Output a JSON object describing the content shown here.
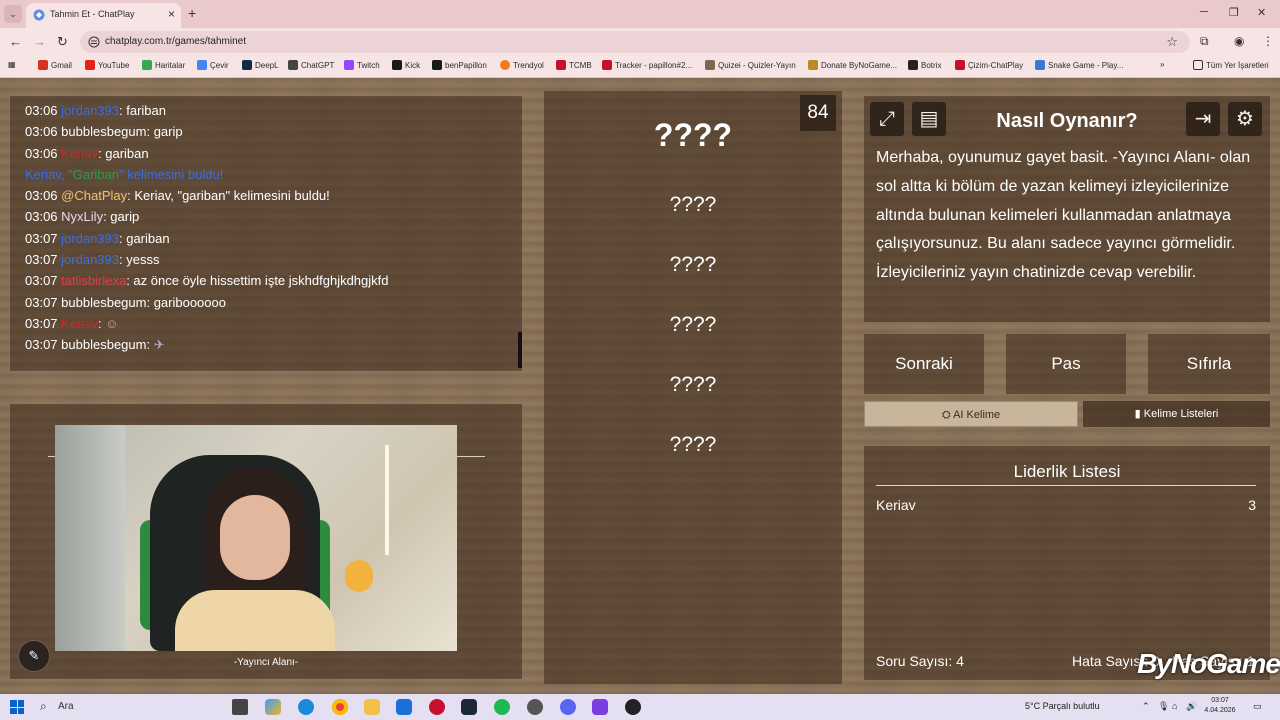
{
  "browser": {
    "tab_title": "Tahmin Et - ChatPlay",
    "url": "chatplay.com.tr/games/tahminet",
    "bookmarks": [
      "Gmail",
      "YouTube",
      "Haritalar",
      "Çevir",
      "DeepL",
      "ChatGPT",
      "Twitch",
      "Kick",
      "benPapillon",
      "Trendyol",
      "TCMB",
      "Tracker - papillon#2...",
      "Quizei - Quizler-Yayın",
      "Donate ByNoGame...",
      "Botrix",
      "Çizim-ChatPlay",
      "Snake Game - Play..."
    ],
    "all_bookmarks": "Tüm Yer İşaretleri"
  },
  "chat": {
    "messages": [
      {
        "time": "03:06",
        "user": "jordan393",
        "user_color": "#3c6fd9",
        "text": ": fariban",
        "text_color": "#ffffff"
      },
      {
        "time": "03:06",
        "user": "bubblesbegum",
        "user_color": "#ffffff",
        "text": ": garip",
        "text_color": "#ffffff"
      },
      {
        "time": "03:06",
        "user": "Keriav",
        "user_color": "#d2262c",
        "text": ": gariban",
        "text_color": "#ffffff"
      },
      {
        "time": "",
        "user": "Keriav, ",
        "user_color": "#3c6fd9",
        "text": "\"Gariban\" kelimesini buldu!",
        "text_color": "#3c6fd9",
        "highlight": "Gariban"
      },
      {
        "time": "03:06",
        "user": "@ChatPlay",
        "user_color": "#f0c36a",
        "text": ": Keriav, \"gariban\" kelimesini buldu!",
        "text_color": "#ffffff"
      },
      {
        "time": "03:06",
        "user": "NyxLily",
        "user_color": "#e8d8f3",
        "text": ": garip",
        "text_color": "#ffffff"
      },
      {
        "time": "03:07",
        "user": "jordan393",
        "user_color": "#3c6fd9",
        "text": ": gariban",
        "text_color": "#ffffff"
      },
      {
        "time": "03:07",
        "user": "jordan393",
        "user_color": "#3c6fd9",
        "text": ": yesss",
        "text_color": "#ffffff"
      },
      {
        "time": "03:07",
        "user": "tatlisbirlexa",
        "user_color": "#e03a4e",
        "text": ": az önce öyle hissettim işte jskhdfghjkdhgjkfd",
        "text_color": "#ffffff"
      },
      {
        "time": "03:07",
        "user": "bubblesbegum",
        "user_color": "#ffffff",
        "text": ": gariboooooo",
        "text_color": "#ffffff"
      },
      {
        "time": "03:07",
        "user": "Keriav",
        "user_color": "#d2262c",
        "text": ": ",
        "text_color": "#ffffff"
      },
      {
        "time": "03:07",
        "user": "bubblesbegum",
        "user_color": "#ffffff",
        "text": ": ",
        "text_color": "#ffffff"
      }
    ]
  },
  "streamer": {
    "label": "-Yayıncı Alanı-"
  },
  "game": {
    "timer": "84",
    "guesses": [
      "????",
      "????",
      "????",
      "????",
      "????",
      "????"
    ]
  },
  "howto": {
    "title": "Nasıl Oynanır?",
    "text": "Merhaba, oyunumuz gayet basit. -Yayıncı Alanı- olan sol altta ki bölüm de yazan kelimeyi izleyicilerinize altında bulunan kelimeleri kullanmadan anlatmaya çalışıyorsunuz. Bu alanı sadece yayıncı görmelidir. İzleyicileriniz yayın chatinizde cevap verebilir."
  },
  "controls": {
    "next": "Sonraki",
    "pass": "Pas",
    "reset": "Sıfırla",
    "ai_word": "AI Kelime",
    "word_lists": "Kelime Listeleri"
  },
  "leaderboard": {
    "title": "Liderlik Listesi",
    "rows": [
      {
        "name": "Keriav",
        "score": "3"
      }
    ],
    "questions": "Soru Sayısı: 4",
    "errors": "Hata Sayısı: 0",
    "passes": "Pas Sayısı: 1"
  },
  "watermark": "ByNoGame",
  "taskbar": {
    "search": "Ara",
    "weather": "5°C  Parçalı bulutlu",
    "time": "03:07",
    "date": "4.04.2026"
  }
}
